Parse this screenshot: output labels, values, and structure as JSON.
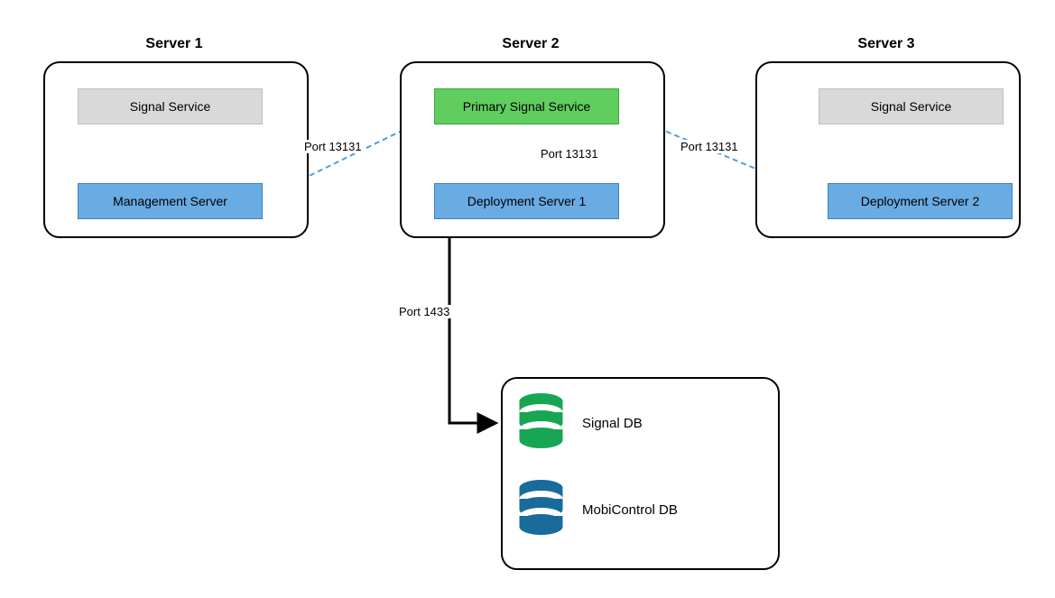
{
  "diagram": {
    "servers": [
      {
        "title": "Server 1",
        "signal": "Signal Service",
        "role": "Management Server"
      },
      {
        "title": "Server 2",
        "signal": "Primary Signal Service",
        "role": "Deployment Server 1"
      },
      {
        "title": "Server 3",
        "signal": "Signal Service",
        "role": "Deployment Server 2"
      }
    ],
    "edges": {
      "mgmt_to_primary": "Port 13131",
      "deploy1_to_primary": "Port 13131",
      "deploy2_to_primary": "Port 13131",
      "primary_to_db": "Port 1433"
    },
    "databases": {
      "signal": "Signal DB",
      "mobicontrol": "MobiControl DB"
    },
    "colors": {
      "blue_arrow": "#4f9ee3",
      "black_arrow": "#000000",
      "node_gray": "#d9d9d9",
      "node_blue": "#69abe3",
      "node_green": "#5fce5f",
      "db_green": "#17a653",
      "db_blue": "#196b9c"
    }
  }
}
